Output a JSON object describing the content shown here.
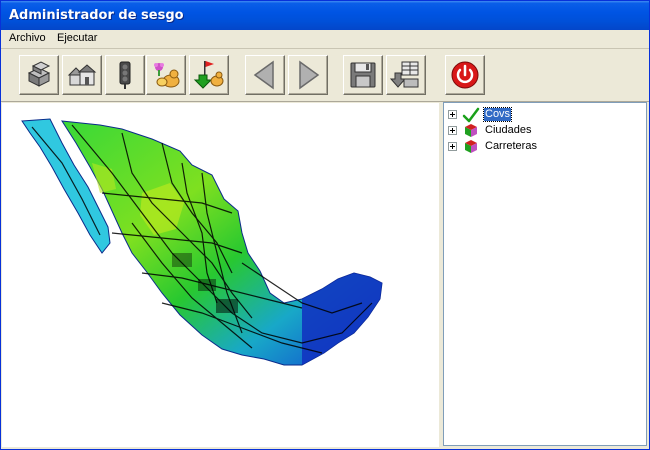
{
  "window": {
    "title": "Administrador de sesgo"
  },
  "menu": {
    "items": [
      "Archivo",
      "Ejecutar"
    ]
  },
  "toolbar": {
    "buttons": [
      {
        "name": "layers-stack-icon"
      },
      {
        "name": "houses-icon"
      },
      {
        "name": "traffic-light-icon"
      },
      {
        "name": "animals-icon"
      },
      {
        "name": "flag-download-icon"
      },
      {
        "name": "arrow-left-icon"
      },
      {
        "name": "arrow-right-icon"
      },
      {
        "name": "save-icon"
      },
      {
        "name": "export-table-icon"
      },
      {
        "name": "power-icon"
      }
    ]
  },
  "tree": {
    "items": [
      {
        "label": "Covs",
        "icon": "checkmark-icon",
        "selected": true
      },
      {
        "label": "Ciudades",
        "icon": "layer-cubes-icon",
        "selected": false
      },
      {
        "label": "Carreteras",
        "icon": "layer-cubes-icon",
        "selected": false
      }
    ]
  },
  "colors": {
    "title_bar": "#0054e3",
    "selection": "#316ac5",
    "chrome": "#ece9d8"
  }
}
